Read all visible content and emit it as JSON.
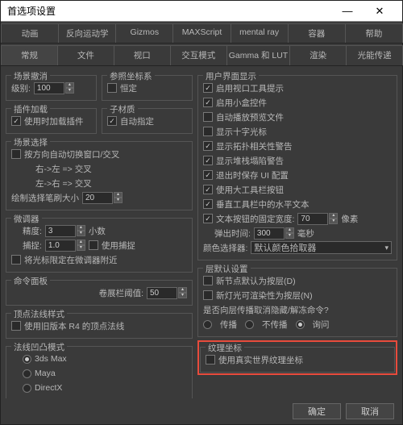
{
  "title": "首选项设置",
  "tabs1": [
    "动画",
    "反向运动学",
    "Gizmos",
    "MAXScript",
    "mental ray",
    "容器",
    "帮助"
  ],
  "tabs2": [
    "常规",
    "文件",
    "视口",
    "交互模式",
    "Gamma 和 LUT",
    "渲染",
    "光能传递"
  ],
  "sceneUndo": {
    "title": "场景撤消",
    "level_label": "级别:",
    "level": "100"
  },
  "refCoord": {
    "title": "参照坐标系",
    "const_label": "恒定"
  },
  "plugin": {
    "title": "插件加载",
    "use_label": "使用时加载插件"
  },
  "sub": {
    "title": "子材质",
    "auto_label": "自动指定"
  },
  "sceneSel": {
    "title": "场景选择",
    "auto_switch": "按方向自动切换窗口/交叉",
    "rl": "右->左 => 交叉",
    "lr": "左->右 => 交叉",
    "brush_label": "绘制选择笔刷大小",
    "brush": "20"
  },
  "spinner": {
    "title": "微调器",
    "precision_label": "精度:",
    "precision": "3",
    "decimal": "小数",
    "snap_label": "捕捉:",
    "snap": "1.0",
    "use_snap": "使用捕捉",
    "limit": "将光标限定在微调器附近"
  },
  "cmd": {
    "title": "命令面板",
    "rollout_label": "卷展栏阈值:",
    "rollout": "50"
  },
  "vnorm": {
    "title": "顶点法线样式",
    "use_r4": "使用旧版本 R4 的顶点法线"
  },
  "normMode": {
    "title": "法线凹凸模式",
    "o1": "3ds Max",
    "o2": "Maya",
    "o3": "DirectX"
  },
  "ui": {
    "title": "用户界面显示",
    "i1": "启用视口工具提示",
    "i2": "启用小盒控件",
    "i3": "自动播放预览文件",
    "i4": "显示十字光标",
    "i5": "显示拓扑相关性警告",
    "i6": "显示堆栈塌陷警告",
    "i7": "退出时保存 UI 配置",
    "i8": "使用大工具栏按钮",
    "i9": "垂直工具栏中的水平文本",
    "i10": "文本按钮的固定宽度:",
    "fixed_width": "70",
    "px": "像素",
    "popup_label": "弹出时间:",
    "popup": "300",
    "ms": "毫秒",
    "picker_label": "颜色选择器:",
    "picker": "默认颜色拾取器"
  },
  "layer": {
    "title": "层默认设置",
    "l1": "新节点默认为按层(D)",
    "l2": "新灯光可渲染性为按层(N)",
    "q": "是否向层传播取消隐藏/解冻命令?",
    "p1": "传播",
    "p2": "不传播",
    "p3": "询问"
  },
  "tex": {
    "title": "纹理坐标",
    "use_real": "使用真实世界纹理坐标"
  },
  "footer": {
    "ok": "确定",
    "cancel": "取消"
  }
}
